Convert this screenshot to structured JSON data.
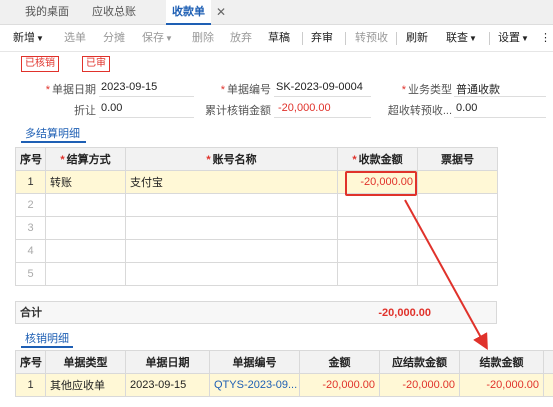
{
  "tabs": [
    {
      "label": "我的桌面"
    },
    {
      "label": "应收总账"
    },
    {
      "label": "收款单"
    }
  ],
  "tab_close": "✕",
  "toolbar": {
    "new": "新增",
    "select": "选单",
    "split": "分摊",
    "save": "保存",
    "delete": "删除",
    "abandon": "放弃",
    "draft": "草稿",
    "unaudit": "弃审",
    "to_prepay": "转预收",
    "refresh": "刷新",
    "linked_query": "联查",
    "settings": "设置"
  },
  "stamps": {
    "verified": "已核销",
    "audited": "已审"
  },
  "form": {
    "doc_date_label": "单据日期",
    "doc_date": "2023-09-15",
    "doc_no_label": "单据编号",
    "doc_no": "SK-2023-09-0004",
    "biz_type_label": "业务类型",
    "biz_type": "普通收款",
    "discount_label": "折让",
    "discount": "0.00",
    "cum_verify_label": "累计核销金额",
    "cum_verify": "-20,000.00",
    "over_prepay_label": "超收转预收...",
    "over_prepay": "0.00"
  },
  "settle": {
    "title": "多结算明细",
    "headers": [
      "序号",
      "结算方式",
      "账号名称",
      "收款金额",
      "票据号"
    ],
    "rows": [
      {
        "idx": "1",
        "method": "转账",
        "account": "支付宝",
        "amount": "-20,000.00",
        "bill": ""
      },
      {
        "idx": "2",
        "method": "",
        "account": "",
        "amount": "",
        "bill": ""
      },
      {
        "idx": "3",
        "method": "",
        "account": "",
        "amount": "",
        "bill": ""
      },
      {
        "idx": "4",
        "method": "",
        "account": "",
        "amount": "",
        "bill": ""
      },
      {
        "idx": "5",
        "method": "",
        "account": "",
        "amount": "",
        "bill": ""
      }
    ],
    "total_label": "合计",
    "total_amount": "-20,000.00"
  },
  "verify": {
    "title": "核销明细",
    "headers": [
      "序号",
      "单据类型",
      "单据日期",
      "单据编号",
      "金额",
      "应结款金额",
      "结款金额"
    ],
    "rows": [
      {
        "idx": "1",
        "type": "其他应收单",
        "date": "2023-09-15",
        "no": "QTYS-2023-09...",
        "amount": "-20,000.00",
        "due": "-20,000.00",
        "settled": "-20,000.00"
      }
    ]
  },
  "colors": {
    "accent": "#1e5fb4",
    "red": "#e0322b",
    "selected_row": "#fff8d6"
  }
}
